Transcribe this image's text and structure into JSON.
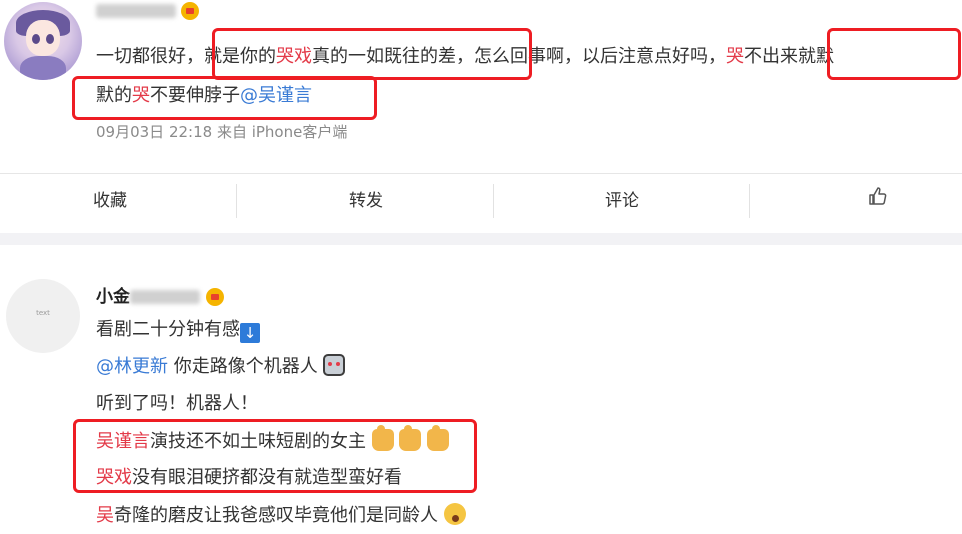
{
  "post1": {
    "name_visible": "",
    "lines": [
      [
        {
          "text": "一切都很好，",
          "style": "normal"
        },
        {
          "text": "就是你的",
          "style": "normal"
        },
        {
          "text": "哭戏",
          "style": "red"
        },
        {
          "text": "真的一如既往的差，",
          "style": "normal"
        },
        {
          "text": "怎么回事啊，以后注意点好吗，",
          "style": "normal"
        },
        {
          "text": "哭",
          "style": "red"
        },
        {
          "text": "不出来就默",
          "style": "normal"
        }
      ],
      [
        {
          "text": "默的",
          "style": "normal"
        },
        {
          "text": "哭",
          "style": "red"
        },
        {
          "text": "不要伸脖子",
          "style": "normal"
        },
        {
          "text": "@吴谨言",
          "style": "blue"
        }
      ]
    ],
    "meta": "09月03日 22:18  来自 iPhone客户端"
  },
  "actions": {
    "favorite": "收藏",
    "repost": "转发",
    "comment": "评论",
    "like_icon": "thumbs-up-icon"
  },
  "post2": {
    "name_visible": "小金",
    "avatar_text": "text",
    "line1": "看剧二十分钟有感",
    "line2_mention": "@林更新",
    "line2_text": " 你走路像个机器人",
    "line3": "听到了吗！机器人！",
    "line4_red": "吴谨言",
    "line4_text": "演技还不如土味短剧的女主",
    "line5_red": "哭戏",
    "line5_text": "没有眼泪硬挤都没有就造型蛮好看",
    "line6_red": "吴",
    "line6_text": "奇隆的磨皮让我爸感叹毕竟他们是同龄人"
  },
  "colors": {
    "highlight_box": "#ee1d23",
    "accent_red": "#e33a48",
    "link_blue": "#3a7bd5"
  }
}
